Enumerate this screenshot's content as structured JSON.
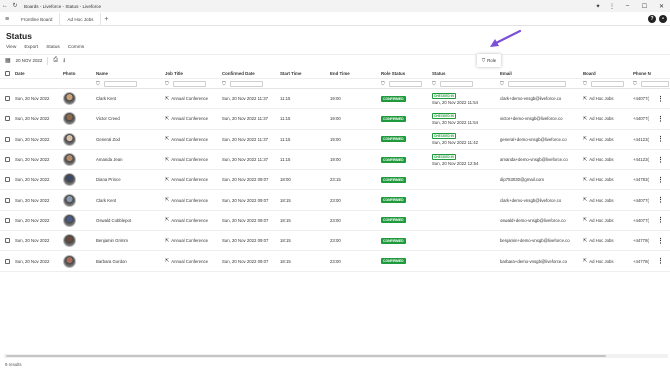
{
  "window": {
    "title": "Boards - Liveforce - Status - Liveforce"
  },
  "tabs": [
    {
      "label": "Frontline Board"
    },
    {
      "label": "Ad Hoc Jobs"
    }
  ],
  "page": {
    "title": "Status"
  },
  "subnav": [
    "View",
    "Export",
    "Status",
    "Comms"
  ],
  "toolbar": {
    "date": "20 NOV 2022"
  },
  "popup": {
    "label": "Role"
  },
  "columns": [
    "Date",
    "Photo",
    "Name",
    "Job Title",
    "Confirmed Date",
    "Start Time",
    "End Time",
    "Role Status",
    "Status",
    "Email",
    "Board",
    "Phone N"
  ],
  "rows": [
    {
      "date": "Sun, 20 Nov 2022",
      "name": "Clark Kent",
      "job": "Annual Conference",
      "confirmed": "Sun, 20 Nov 2022 11:37",
      "start": "11:15",
      "end": "19:00",
      "role_status": "CONFIRMED",
      "status": "CHECKED IN",
      "status_time": "Sun, 20 Nov 2022 11:54",
      "email": "clark+demo-vnsgb@liveforce.co",
      "board": "Ad Hoc Jobs",
      "phone": "+44077("
    },
    {
      "date": "Sun, 20 Nov 2022",
      "name": "Victor Creed",
      "job": "Annual Conference",
      "confirmed": "Sun, 20 Nov 2022 11:37",
      "start": "11:15",
      "end": "19:00",
      "role_status": "CONFIRMED",
      "status": "CHECKED IN",
      "status_time": "Sun, 20 Nov 2022 11:54",
      "email": "victor+demo-vnsgb@liveforce.co",
      "board": "Ad Hoc Jobs",
      "phone": "+44077("
    },
    {
      "date": "Sun, 20 Nov 2022",
      "name": "General Zod",
      "job": "Annual Conference",
      "confirmed": "Sun, 20 Nov 2022 11:37",
      "start": "11:15",
      "end": "19:00",
      "role_status": "CONFIRMED",
      "status": "CHECKED IN",
      "status_time": "Sun, 20 Nov 2022 11:42",
      "email": "general+demo-vnsgb@liveforce.co",
      "board": "Ad Hoc Jobs",
      "phone": "+44123("
    },
    {
      "date": "Sun, 20 Nov 2022",
      "name": "Amanda Jean",
      "job": "Annual Conference",
      "confirmed": "Sun, 20 Nov 2022 11:37",
      "start": "11:15",
      "end": "19:00",
      "role_status": "CONFIRMED",
      "status": "CHECKED IN",
      "status_time": "Sun, 20 Nov 2022 12:54",
      "email": "amanda+demo-vnsgb@liveforce.co",
      "board": "Ad Hoc Jobs",
      "phone": "+44123("
    },
    {
      "date": "Sun, 20 Nov 2022",
      "name": "Diana Prince",
      "job": "Annual Conference",
      "confirmed": "Sun, 20 Nov 2022 09:07",
      "start": "18:00",
      "end": "23:15",
      "role_status": "CONFIRMED",
      "status": "",
      "status_time": "",
      "email": "dip753030@gmail.com",
      "board": "Ad Hoc Jobs",
      "phone": "+44783("
    },
    {
      "date": "Sun, 20 Nov 2022",
      "name": "Clark Kent",
      "job": "Annual Conference",
      "confirmed": "Sun, 20 Nov 2022 09:07",
      "start": "18:15",
      "end": "23:00",
      "role_status": "CONFIRMED",
      "status": "",
      "status_time": "",
      "email": "clark+demo-vnsgb@liveforce.co",
      "board": "Ad Hoc Jobs",
      "phone": "+44077("
    },
    {
      "date": "Sun, 20 Nov 2022",
      "name": "Oswald Cobblepot",
      "job": "Annual Conference",
      "confirmed": "Sun, 20 Nov 2022 09:07",
      "start": "18:15",
      "end": "23:00",
      "role_status": "CONFIRMED",
      "status": "",
      "status_time": "",
      "email": "oswald+demo-vnsgb@liveforce.co",
      "board": "Ad Hoc Jobs",
      "phone": "+44077("
    },
    {
      "date": "Sun, 20 Nov 2022",
      "name": "Benjamin Grimm",
      "job": "Annual Conference",
      "confirmed": "Sun, 20 Nov 2022 09:07",
      "start": "18:15",
      "end": "23:00",
      "role_status": "CONFIRMED",
      "status": "",
      "status_time": "",
      "email": "benjamin+demo-vnsgb@liveforce.co",
      "board": "Ad Hoc Jobs",
      "phone": "+44778("
    },
    {
      "date": "Sun, 20 Nov 2022",
      "name": "Barbara Gordon",
      "job": "Annual Conference",
      "confirmed": "Sun, 20 Nov 2022 09:07",
      "start": "18:15",
      "end": "23:00",
      "role_status": "CONFIRMED",
      "status": "",
      "status_time": "",
      "email": "barbara+demo-vnsgb@liveforce.co",
      "board": "Ad Hoc Jobs",
      "phone": "+44778("
    }
  ],
  "footer": {
    "results": "9 results"
  },
  "colors": {
    "accent": "#7b4fd8",
    "confirmed": "#1f9a3c"
  }
}
